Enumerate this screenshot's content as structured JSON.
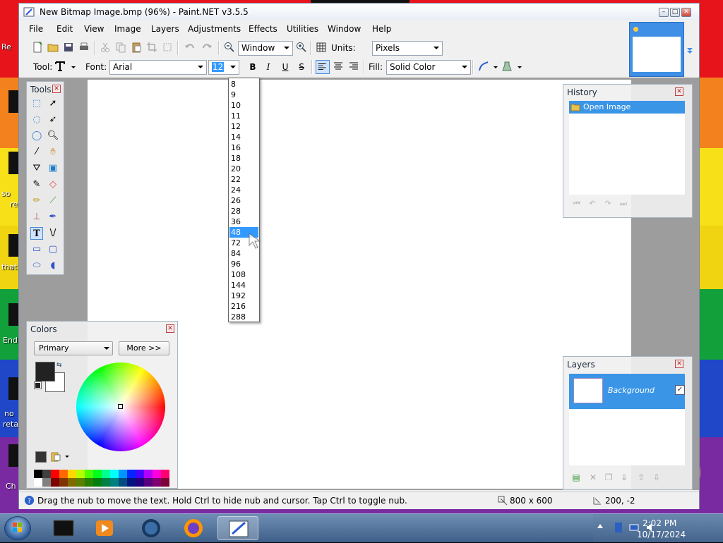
{
  "window": {
    "title": "New Bitmap Image.bmp (96%) - Paint.NET v3.5.5",
    "controls": {
      "minimize": "–",
      "maximize": "□",
      "close": "✕"
    }
  },
  "menu": [
    "File",
    "Edit",
    "View",
    "Image",
    "Layers",
    "Adjustments",
    "Effects",
    "Utilities",
    "Window",
    "Help"
  ],
  "toolbar1": {
    "zoom_value": "Window",
    "units_label": "Units:",
    "units_value": "Pixels"
  },
  "toolbar2": {
    "tool_label": "Tool:",
    "font_label": "Font:",
    "font_value": "Arial",
    "font_size_value": "12",
    "bold": "B",
    "italic": "I",
    "underline": "U",
    "strike": "S",
    "fill_label": "Fill:",
    "fill_value": "Solid Color"
  },
  "font_size_options": [
    "8",
    "9",
    "10",
    "11",
    "12",
    "14",
    "16",
    "18",
    "20",
    "22",
    "24",
    "26",
    "28",
    "36",
    "48",
    "72",
    "84",
    "96",
    "108",
    "144",
    "192",
    "216",
    "288"
  ],
  "font_size_highlighted": "48",
  "tools_panel": {
    "title": "Tools",
    "close": "✕"
  },
  "history_panel": {
    "title": "History",
    "close": "✕",
    "items": [
      "Open Image"
    ]
  },
  "layers_panel": {
    "title": "Layers",
    "close": "✕",
    "layer_name": "Background",
    "visible_check": "✓"
  },
  "colors_panel": {
    "title": "Colors",
    "close": "✕",
    "mode_value": "Primary",
    "more_button": "More >>",
    "primary_color": "#222222",
    "secondary_color": "#ffffff"
  },
  "status": {
    "message": "Drag the nub to move the text. Hold Ctrl to hide nub and cursor. Tap Ctrl to toggle nub.",
    "image_size": "800 x 600",
    "cursor_position": "200, -2"
  },
  "desktop_labels": [
    "Re",
    "so",
    "re",
    "that",
    "End",
    "no",
    "reta",
    "Ch"
  ],
  "clock": {
    "time": "2:02 PM",
    "date": "10/17/2024"
  },
  "colors": {
    "accent": "#3399ff",
    "selection": "#3b95e7",
    "workspace": "#9d9d9d"
  }
}
